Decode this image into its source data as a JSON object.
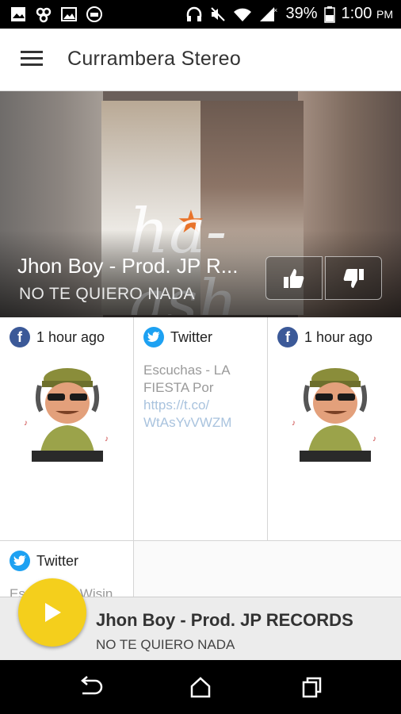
{
  "status_bar": {
    "battery": "39%",
    "time": "1:00",
    "ampm": "PM",
    "icons": [
      "gallery-icon",
      "infinity-icon",
      "image-icon",
      "radio-icon",
      "headphones-icon",
      "mute-icon",
      "wifi-icon",
      "signal-icon",
      "battery-icon"
    ]
  },
  "app_bar": {
    "title": "Currambera Stereo",
    "menu_icon": "hamburger-menu-icon"
  },
  "hero": {
    "artist": "Jhon Boy - Prod. JP R...",
    "song": "NO TE QUIERO NADA",
    "album_art_text": "ha-ash",
    "like_icon": "thumbs-up-icon",
    "dislike_icon": "thumbs-down-icon"
  },
  "feed": {
    "cards": [
      {
        "source": "facebook",
        "label": "1 hour ago"
      },
      {
        "source": "twitter",
        "label": "Twitter",
        "text": "Escuchas  - LA FIESTA Por",
        "link": "https://t.co/ WtAsYvVWZM"
      },
      {
        "source": "facebook",
        "label": "1 hour ago"
      },
      {
        "source": "twitter",
        "label": "Twitter",
        "text": "Escuchas - Wisin"
      }
    ]
  },
  "player": {
    "artist": "Jhon Boy - Prod. JP RECORDS",
    "song": "NO TE QUIERO NADA",
    "accent": "#f4cf1c"
  },
  "colors": {
    "facebook": "#3b5998",
    "twitter": "#1da1f2",
    "play": "#f4cf1c"
  }
}
